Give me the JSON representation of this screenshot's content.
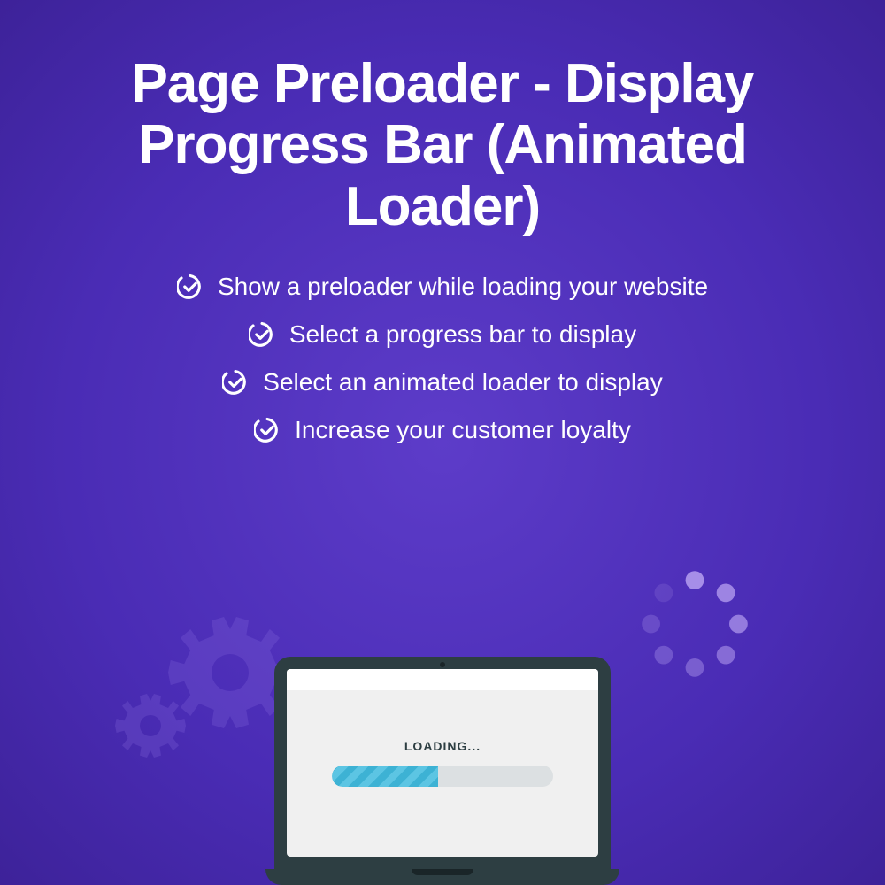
{
  "title": "Page Preloader - Display Progress Bar (Animated Loader)",
  "features": [
    "Show a preloader while loading your website",
    "Select a progress bar to display",
    "Select an animated loader to display",
    "Increase your customer loyalty"
  ],
  "illustration": {
    "loading_text": "LOADING..."
  }
}
